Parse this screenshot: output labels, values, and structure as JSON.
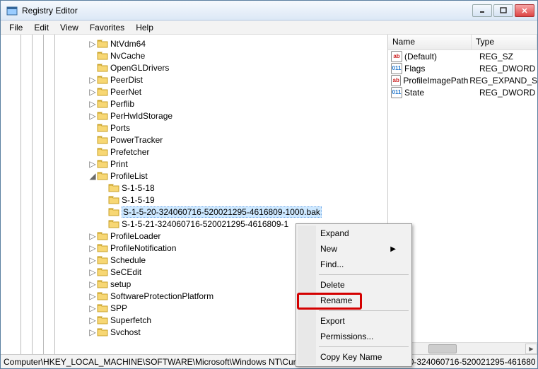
{
  "window": {
    "title": "Registry Editor"
  },
  "menubar": [
    "File",
    "Edit",
    "View",
    "Favorites",
    "Help"
  ],
  "tree": {
    "items": [
      {
        "label": "NtVdm64",
        "level": 0,
        "exp": "▷"
      },
      {
        "label": "NvCache",
        "level": 0,
        "exp": ""
      },
      {
        "label": "OpenGLDrivers",
        "level": 0,
        "exp": ""
      },
      {
        "label": "PeerDist",
        "level": 0,
        "exp": "▷"
      },
      {
        "label": "PeerNet",
        "level": 0,
        "exp": "▷"
      },
      {
        "label": "Perflib",
        "level": 0,
        "exp": "▷"
      },
      {
        "label": "PerHwIdStorage",
        "level": 0,
        "exp": "▷"
      },
      {
        "label": "Ports",
        "level": 0,
        "exp": ""
      },
      {
        "label": "PowerTracker",
        "level": 0,
        "exp": ""
      },
      {
        "label": "Prefetcher",
        "level": 0,
        "exp": ""
      },
      {
        "label": "Print",
        "level": 0,
        "exp": "▷"
      },
      {
        "label": "ProfileList",
        "level": 0,
        "exp": "◢"
      },
      {
        "label": "S-1-5-18",
        "level": 1,
        "exp": ""
      },
      {
        "label": "S-1-5-19",
        "level": 1,
        "exp": ""
      },
      {
        "label": "S-1-5-20-324060716-520021295-4616809-1000.bak",
        "level": 1,
        "exp": "",
        "selected": true
      },
      {
        "label": "S-1-5-21-324060716-520021295-4616809-1",
        "level": 1,
        "exp": ""
      },
      {
        "label": "ProfileLoader",
        "level": 0,
        "exp": "▷"
      },
      {
        "label": "ProfileNotification",
        "level": 0,
        "exp": "▷"
      },
      {
        "label": "Schedule",
        "level": 0,
        "exp": "▷"
      },
      {
        "label": "SeCEdit",
        "level": 0,
        "exp": "▷"
      },
      {
        "label": "setup",
        "level": 0,
        "exp": "▷"
      },
      {
        "label": "SoftwareProtectionPlatform",
        "level": 0,
        "exp": "▷"
      },
      {
        "label": "SPP",
        "level": 0,
        "exp": "▷"
      },
      {
        "label": "Superfetch",
        "level": 0,
        "exp": "▷"
      },
      {
        "label": "Svchost",
        "level": 0,
        "exp": "▷"
      }
    ]
  },
  "list": {
    "headers": {
      "name": "Name",
      "type": "Type"
    },
    "rows": [
      {
        "icon": "str",
        "iconText": "ab",
        "name": "(Default)",
        "type": "REG_SZ"
      },
      {
        "icon": "num",
        "iconText": "011",
        "name": "Flags",
        "type": "REG_DWORD"
      },
      {
        "icon": "str",
        "iconText": "ab",
        "name": "ProfileImagePath",
        "type": "REG_EXPAND_S"
      },
      {
        "icon": "num",
        "iconText": "011",
        "name": "State",
        "type": "REG_DWORD"
      }
    ]
  },
  "contextmenu": {
    "expand": "Expand",
    "new": "New",
    "find": "Find...",
    "delete": "Delete",
    "rename": "Rename",
    "export": "Export",
    "permissions": "Permissions...",
    "copykey": "Copy Key Name"
  },
  "statusbar": "Computer\\HKEY_LOCAL_MACHINE\\SOFTWARE\\Microsoft\\Windows NT\\CurrentVersion\\ProfileList\\S-1-5-20-324060716-520021295-461680"
}
